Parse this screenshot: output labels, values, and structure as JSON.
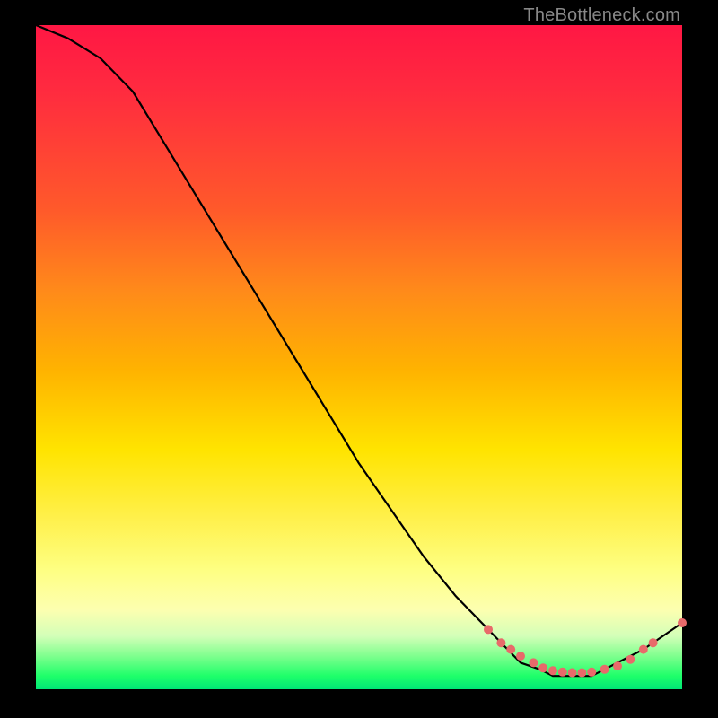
{
  "watermark": "TheBottleneck.com",
  "chart_data": {
    "type": "line",
    "title": "",
    "xlabel": "",
    "ylabel": "",
    "xlim": [
      0,
      100
    ],
    "ylim": [
      0,
      100
    ],
    "grid": false,
    "series": [
      {
        "name": "curve",
        "x": [
          0,
          5,
          10,
          15,
          20,
          25,
          30,
          35,
          40,
          45,
          50,
          55,
          60,
          65,
          70,
          73,
          75,
          78,
          80,
          82,
          84,
          86,
          88,
          90,
          92,
          94,
          100
        ],
        "values": [
          100,
          98,
          95,
          90,
          82,
          74,
          66,
          58,
          50,
          42,
          34,
          27,
          20,
          14,
          9,
          6,
          4,
          3,
          2,
          2,
          2,
          2,
          3,
          4,
          5,
          6,
          10
        ]
      }
    ],
    "markers": [
      {
        "x": 70,
        "y": 9
      },
      {
        "x": 72,
        "y": 7
      },
      {
        "x": 73.5,
        "y": 6
      },
      {
        "x": 75,
        "y": 5
      },
      {
        "x": 77,
        "y": 4
      },
      {
        "x": 78.5,
        "y": 3.2
      },
      {
        "x": 80,
        "y": 2.8
      },
      {
        "x": 81.5,
        "y": 2.6
      },
      {
        "x": 83,
        "y": 2.5
      },
      {
        "x": 84.5,
        "y": 2.5
      },
      {
        "x": 86,
        "y": 2.6
      },
      {
        "x": 88,
        "y": 3
      },
      {
        "x": 90,
        "y": 3.5
      },
      {
        "x": 92,
        "y": 4.5
      },
      {
        "x": 94,
        "y": 6
      },
      {
        "x": 95.5,
        "y": 7
      },
      {
        "x": 100,
        "y": 10
      }
    ],
    "marker_color": "#e86a6a"
  }
}
